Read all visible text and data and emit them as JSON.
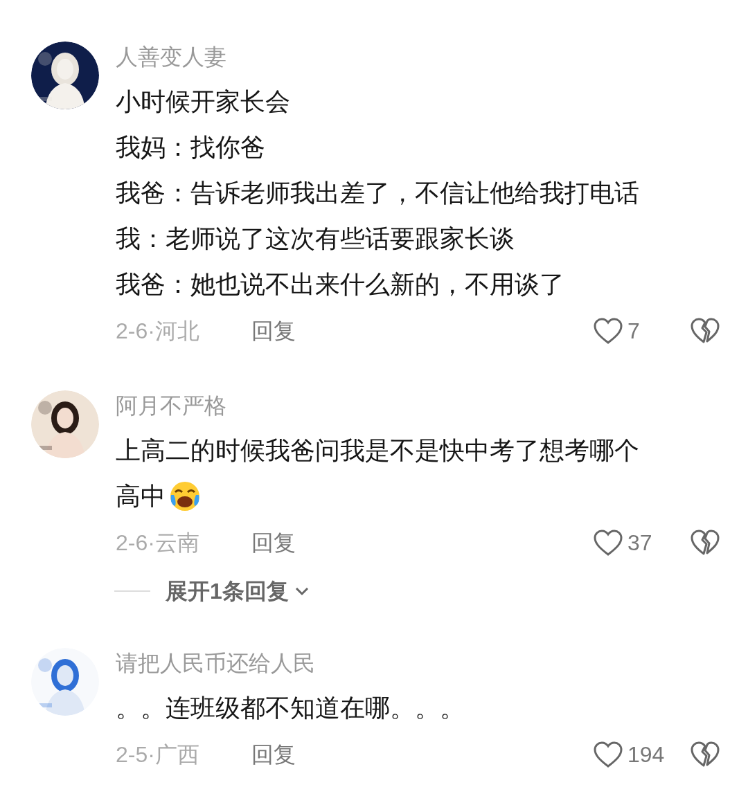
{
  "comments": [
    {
      "author": "人善变人妻",
      "avatar": {
        "kind": "picture"
      },
      "lines": [
        "小时候开家长会",
        "我妈：找你爸",
        "我爸：告诉老师我出差了，不信让他给我打电话",
        "我：老师说了这次有些话要跟家长谈",
        "我爸：她也说不出来什么新的，不用谈了"
      ],
      "date": "2-6·河北",
      "reply_label": "回复",
      "likes": "7",
      "liked": false
    },
    {
      "author": "阿月不严格",
      "avatar": {
        "kind": "picture"
      },
      "lines": [
        "上高二的时候我爸问我是不是快中考了想考哪个",
        "高中"
      ],
      "emoji": true,
      "date": "2-6·云南",
      "reply_label": "回复",
      "likes": "37",
      "liked": false,
      "expand_label": "展开1条回复"
    },
    {
      "author": "请把人民币还给人民",
      "avatar": {
        "kind": "picture"
      },
      "lines": [
        "。。连班级都不知道在哪。。。"
      ],
      "date": "2-5·广西",
      "reply_label": "回复",
      "likes": "194",
      "liked": false
    }
  ]
}
